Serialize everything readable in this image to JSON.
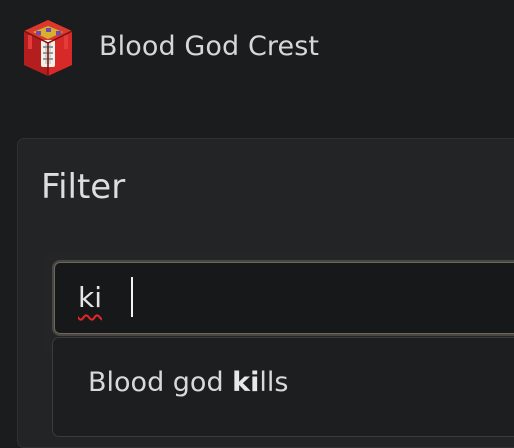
{
  "app": {
    "title": "Blood God Crest",
    "icon": "blood-god-crest-icon"
  },
  "filter": {
    "title": "Filter",
    "query": "ki",
    "spellcheck_error": true,
    "suggestions": [
      {
        "before": "Blood god ",
        "match": "ki",
        "after": "lls"
      }
    ]
  },
  "colors": {
    "background": "#1b1c1e",
    "panel": "#222426",
    "field": "#17181a",
    "text": "#d8d9db",
    "spellcheck": "#e32626",
    "crest_red": "#d72828",
    "crest_gold": "#d6b12f"
  }
}
